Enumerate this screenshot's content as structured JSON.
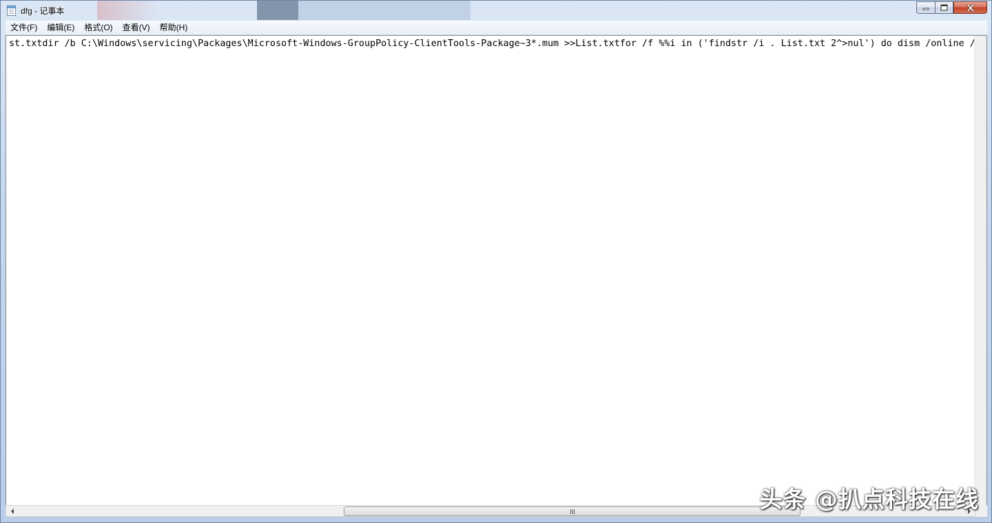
{
  "window": {
    "title": "dfg - 记事本"
  },
  "menu": [
    {
      "label": "文件(F)"
    },
    {
      "label": "编辑(E)"
    },
    {
      "label": "格式(O)"
    },
    {
      "label": "查看(V)"
    },
    {
      "label": "帮助(H)"
    }
  ],
  "editor": {
    "content": "st.txtdir /b C:\\Windows\\servicing\\Packages\\Microsoft-Windows-GroupPolicy-ClientTools-Package~3*.mum >>List.txtfor /f %%i in ('findstr /i . List.txt 2^>nul') do dism /online /n"
  },
  "watermark": {
    "text": "头条 @扒点科技在线"
  },
  "icons": {
    "app": "notepad-icon",
    "minimize": "minimize-icon",
    "maximize": "maximize-icon",
    "close": "close-icon",
    "scroll_left": "arrow-left-icon",
    "scroll_right": "arrow-right-icon",
    "thumb_grip": "grip-icon"
  },
  "colors": {
    "titlebar": "#c5d7ee",
    "close_button": "#c2432a",
    "editor_background": "#ffffff"
  }
}
